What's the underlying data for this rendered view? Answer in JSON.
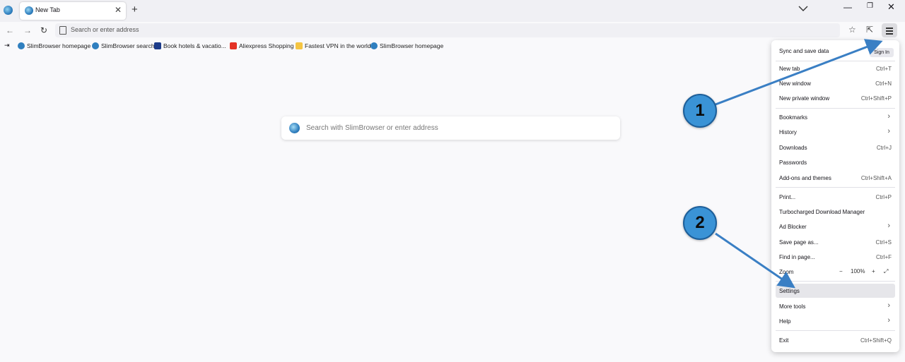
{
  "tab": {
    "title": "New Tab"
  },
  "toolbar": {
    "url_placeholder": "Search or enter address"
  },
  "bookmarks": [
    {
      "label": "SlimBrowser homepage",
      "icon": "slimbrowser-globe-icon",
      "color": "#2f7fbf"
    },
    {
      "label": "SlimBrowser search",
      "icon": "magnifier-globe-icon",
      "color": "#2f7fbf"
    },
    {
      "label": "Book hotels & vacatio...",
      "icon": "booking-icon",
      "color": "#1c3b8a"
    },
    {
      "label": "Aliexpress Shopping",
      "icon": "aliexpress-icon",
      "color": "#e43225"
    },
    {
      "label": "Fastest VPN in the world",
      "icon": "vpn-folder-icon",
      "color": "#f5c542"
    },
    {
      "label": "SlimBrowser homepage",
      "icon": "slimbrowser-globe-icon",
      "color": "#2f7fbf"
    }
  ],
  "search": {
    "placeholder": "Search with SlimBrowser or enter address"
  },
  "menu": {
    "sync_label": "Sync and save data",
    "sign_in": "Sign In",
    "items": [
      {
        "label": "New tab",
        "shortcut": "Ctrl+T"
      },
      {
        "label": "New window",
        "shortcut": "Ctrl+N"
      },
      {
        "label": "New private window",
        "shortcut": "Ctrl+Shift+P"
      },
      {
        "label": "Bookmarks",
        "shortcut": ""
      },
      {
        "label": "History",
        "shortcut": ""
      },
      {
        "label": "Downloads",
        "shortcut": "Ctrl+J"
      },
      {
        "label": "Passwords",
        "shortcut": ""
      },
      {
        "label": "Add-ons and themes",
        "shortcut": "Ctrl+Shift+A"
      },
      {
        "label": "Print...",
        "shortcut": "Ctrl+P"
      },
      {
        "label": "Turbocharged Download Manager",
        "shortcut": ""
      },
      {
        "label": "Ad Blocker",
        "shortcut": ""
      },
      {
        "label": "Save page as...",
        "shortcut": "Ctrl+S"
      },
      {
        "label": "Find in page...",
        "shortcut": "Ctrl+F"
      },
      {
        "label": "Zoom",
        "shortcut": ""
      },
      {
        "label": "Settings",
        "shortcut": ""
      },
      {
        "label": "More tools",
        "shortcut": ""
      },
      {
        "label": "Help",
        "shortcut": ""
      },
      {
        "label": "Exit",
        "shortcut": "Ctrl+Shift+Q"
      }
    ],
    "zoom_value": "100%"
  },
  "annotations": {
    "step1": "1",
    "step2": "2",
    "color": "#3a93d6"
  }
}
